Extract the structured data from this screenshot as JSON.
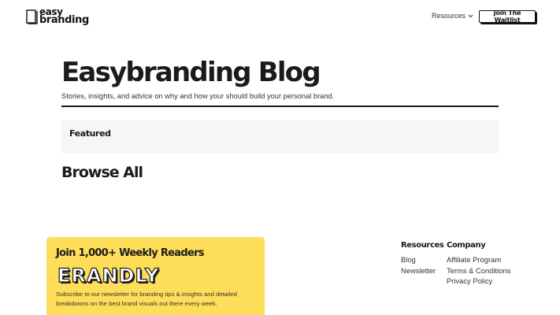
{
  "header": {
    "logo_line1": "easy",
    "logo_line2": "branding",
    "nav_resources": "Resources",
    "cta_label": "Join The Waitlist"
  },
  "hero": {
    "title": "Easybranding Blog",
    "subtitle": "Stories, insights, and advice on why and how your should build your personal brand."
  },
  "featured": {
    "label": "Featured"
  },
  "browse": {
    "title": "Browse All"
  },
  "newsletter": {
    "title": "Join 1,000+ Weekly Readers",
    "brand_logo_text": "ERANDLY",
    "description": "Subscribe to our newsletter for branding tips & insights and detailed breakdowns on the best brand visuals out there every week.",
    "background_color": "#fedd59"
  },
  "footer": {
    "resources": {
      "heading": "Resources",
      "links": [
        "Blog",
        "Newsletter"
      ]
    },
    "company": {
      "heading": "Company",
      "links": [
        "Affiliate Program",
        "Terms & Conditions",
        "Privacy Policy"
      ]
    }
  },
  "icons": {
    "logo": "book-icon",
    "nav_dropdown": "chevron-down-icon"
  }
}
